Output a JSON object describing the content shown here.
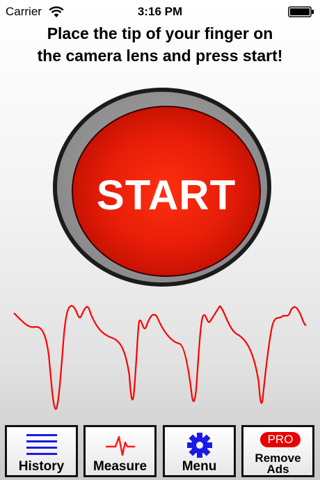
{
  "status_bar": {
    "carrier": "Carrier",
    "time": "3:16 PM"
  },
  "instruction": {
    "line1": "Place the tip of your finger on",
    "line2": "the camera lens and press start!"
  },
  "start_button": {
    "label": "START"
  },
  "tabs": [
    {
      "label": "History",
      "icon": "list-icon"
    },
    {
      "label": "Measure",
      "icon": "heartbeat-icon"
    },
    {
      "label": "Menu",
      "icon": "gear-icon"
    },
    {
      "badge": "PRO",
      "label_line1": "Remove",
      "label_line2": "Ads"
    }
  ],
  "colors": {
    "accent_red": "#e81e08",
    "icon_blue": "#1a1ae6",
    "wave_red": "#ff0000"
  }
}
